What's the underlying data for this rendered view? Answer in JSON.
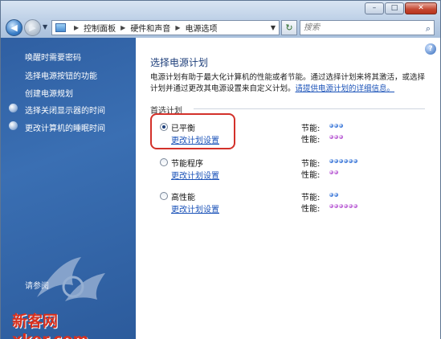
{
  "address": {
    "crumbs": [
      "控制面板",
      "硬件和声音",
      "电源选项"
    ],
    "search_placeholder": "搜索"
  },
  "window_buttons": {
    "minimize": "–",
    "maximize": "□",
    "close": "✕"
  },
  "sidebar": {
    "links": [
      {
        "label": "唤醒时需要密码"
      },
      {
        "label": "选择电源按钮的功能"
      },
      {
        "label": "创建电源规划"
      },
      {
        "label": "选择关闭显示器的时间"
      },
      {
        "label": "更改计算机的睡眠时间"
      }
    ],
    "bottom_label": "请参阅"
  },
  "watermark": {
    "text": "新客网 xker.com"
  },
  "main": {
    "title": "选择电源计划",
    "description_line1": "电源计划有助于最大化计算机的性能或者节能。通过选择计划来将其激活，或选择",
    "description_line2": "计划并通过更改其电源设置来自定义计划。",
    "description_link": "请提供电源计划的详细信息。",
    "section_label": "首选计划",
    "plans": [
      {
        "name": "已平衡",
        "link": "更改计划设置",
        "selected": true,
        "metrics": [
          {
            "label": "节能:",
            "level": 3,
            "color": "#2f6fd6"
          },
          {
            "label": "性能:",
            "level": 3,
            "color": "#b34fd1"
          }
        ]
      },
      {
        "name": "节能程序",
        "link": "更改计划设置",
        "selected": false,
        "metrics": [
          {
            "label": "节能:",
            "level": 6,
            "color": "#2f6fd6"
          },
          {
            "label": "性能:",
            "level": 2,
            "color": "#b34fd1"
          }
        ]
      },
      {
        "name": "高性能",
        "link": "更改计划设置",
        "selected": false,
        "metrics": [
          {
            "label": "节能:",
            "level": 2,
            "color": "#2f6fd6"
          },
          {
            "label": "性能:",
            "level": 6,
            "color": "#b34fd1"
          }
        ]
      }
    ],
    "highlight_color": "#d3312a"
  },
  "icons": {
    "back": "back-arrow-icon",
    "forward": "forward-arrow-icon",
    "refresh": "refresh-icon",
    "search": "search-icon",
    "help": "help-icon"
  }
}
